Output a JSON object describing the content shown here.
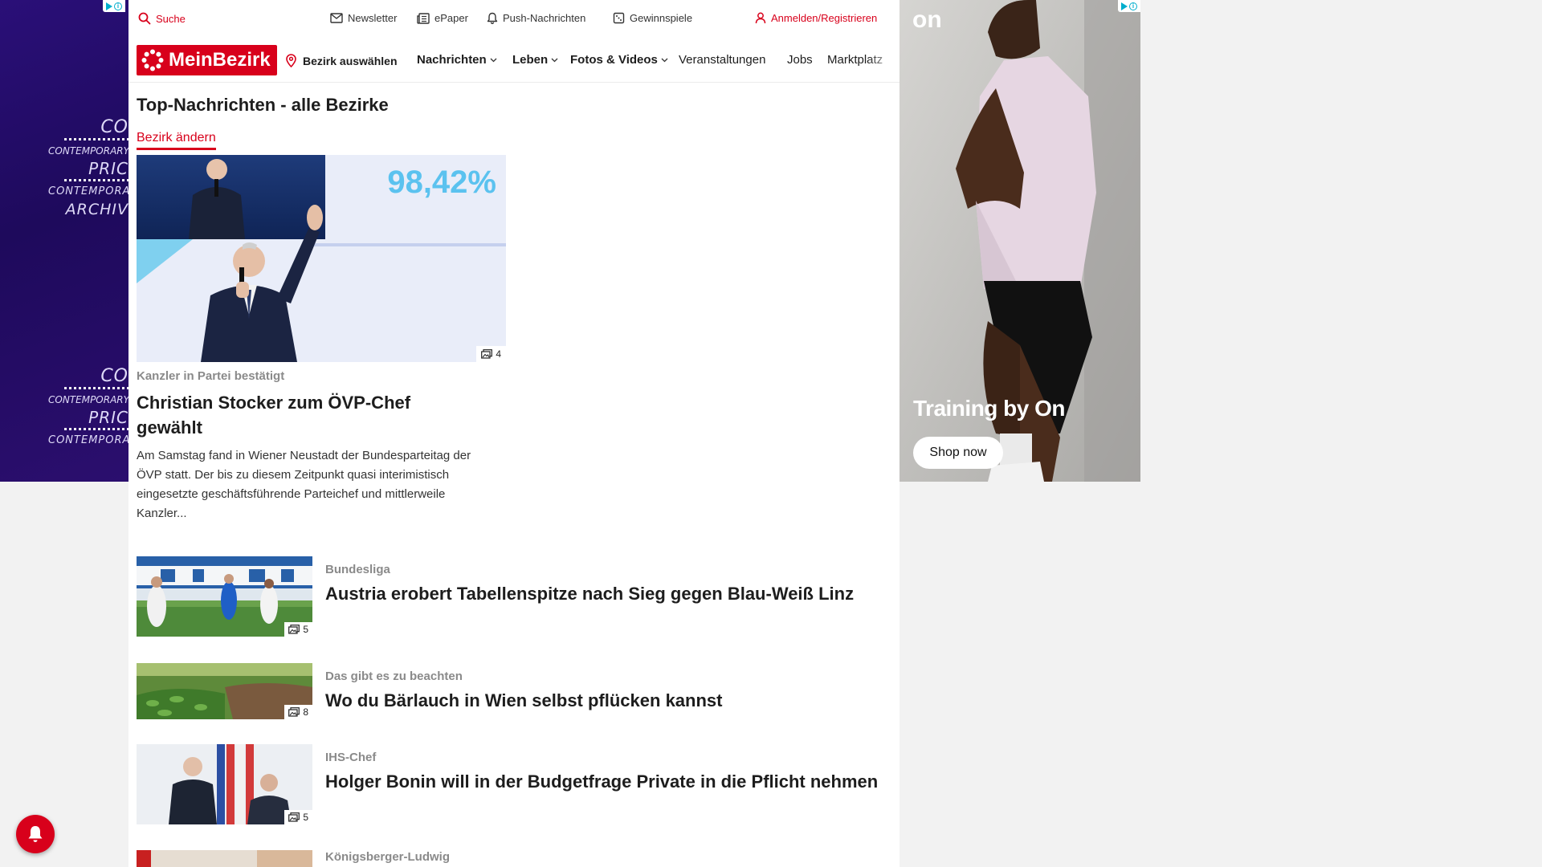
{
  "ad_left": {
    "glitch_lines": [
      "CO",
      "CONTEMPORARY",
      "PRIC",
      "CONTEMPORARY",
      "ARCHIV"
    ],
    "glitch_lines_2": [
      "CO",
      "CONTEMPORARY",
      "PRIC",
      "CONTEMPORARY"
    ]
  },
  "topbar": {
    "search": "Suche",
    "newsletter": "Newsletter",
    "epaper": "ePaper",
    "push": "Push-Nachrichten",
    "gewinnspiele": "Gewinnspiele",
    "login": "Anmelden/Registrieren"
  },
  "nav": {
    "logo": "MeinBezirk",
    "bezirk": "Bezirk auswählen",
    "items": [
      "Nachrichten",
      "Leben",
      "Fotos & Videos",
      "Veranstaltungen",
      "Jobs",
      "Marktplatz"
    ]
  },
  "section": {
    "title": "Top-Nachrichten - alle Bezirke",
    "change_link": "Bezirk ändern"
  },
  "lead": {
    "image_overlay": "98,42%",
    "image_count": "4",
    "kicker": "Kanzler in Partei bestätigt",
    "title": "Christian Stocker zum ÖVP-Chef gewählt",
    "teaser": "Am Samstag fand in Wiener Neustadt der Bundesparteitag der ÖVP statt. Der bis zu diesem Zeitpunkt quasi interimistisch eingesetzte geschäftsführende Parteichef und mittlerweile Kanzler..."
  },
  "articles": [
    {
      "kicker": "Bundesliga",
      "title": "Austria erobert Tabellenspitze nach Sieg gegen Blau-Weiß Linz",
      "image_count": "5"
    },
    {
      "kicker": "Das gibt es zu beachten",
      "title": "Wo du Bärlauch in Wien selbst pflücken kannst",
      "image_count": "8"
    },
    {
      "kicker": "IHS-Chef",
      "title": "Holger Bonin will in der Budgetfrage Private in die Pflicht nehmen",
      "image_count": "5"
    },
    {
      "kicker": "Königsberger-Ludwig",
      "title": "",
      "image_count": ""
    }
  ],
  "ad_right": {
    "brand_logo": "on",
    "headline": "Training by On",
    "button": "Shop now"
  },
  "colors": {
    "brand_red": "#d8001b",
    "kicker_gray": "#8a8a8a",
    "ad_left_bg": "#2a0f78",
    "adchoices": "#00aecd"
  },
  "icons": [
    "search-icon",
    "envelope-icon",
    "newspaper-icon",
    "bell-icon",
    "gift-icon",
    "user-icon",
    "location-pin-icon",
    "chevron-down-icon",
    "gallery-icon",
    "notification-bell-icon",
    "adchoices-icon"
  ]
}
